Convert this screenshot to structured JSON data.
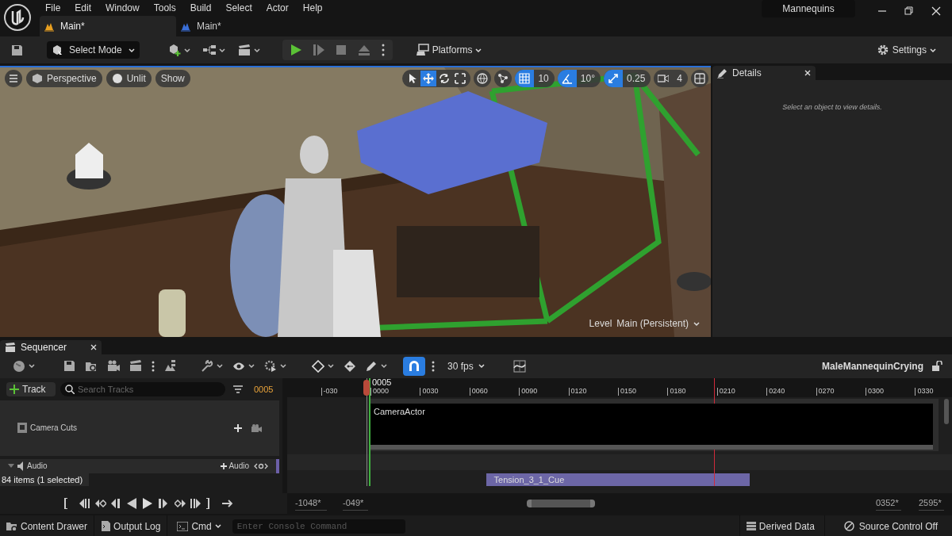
{
  "menu": [
    "File",
    "Edit",
    "Window",
    "Tools",
    "Build",
    "Select",
    "Actor",
    "Help"
  ],
  "tabs": [
    {
      "label": "Main*",
      "selected": true
    },
    {
      "label": "Main*",
      "selected": false
    }
  ],
  "project": "Mannequins",
  "toolbar": {
    "mode": "Select Mode",
    "platforms": "Platforms",
    "settings": "Settings"
  },
  "viewport": {
    "view_buttons": [
      "Perspective",
      "Unlit",
      "Show"
    ],
    "transform_tools": [
      {
        "selected": false
      },
      {
        "selected": true
      },
      {
        "selected": false
      },
      {
        "selected": false
      }
    ],
    "snaps": [
      {
        "kind": "grid",
        "value": "10",
        "on": true
      },
      {
        "kind": "angle",
        "value": "10°",
        "on": true
      },
      {
        "kind": "scale",
        "value": "0.25",
        "on": true
      },
      {
        "kind": "camera",
        "value": "4",
        "on": false
      }
    ],
    "level_label": "Level",
    "level": "Main (Persistent)"
  },
  "details": {
    "title": "Details",
    "message": "Select an object to view details."
  },
  "sequencer": {
    "title": "Sequencer",
    "fps": "30 fps",
    "snapping": {
      "on": true
    },
    "sequence": "MaleMannequinCrying",
    "add_track": "Track",
    "search_placeholder": "Search Tracks",
    "current_frame": "0005",
    "playhead": "0005",
    "ticks": [
      "-030",
      "0000",
      "0030",
      "0060",
      "0090",
      "0120",
      "0150",
      "0180",
      "0210",
      "0240",
      "0270",
      "0300",
      "0330"
    ],
    "tracks": [
      {
        "kind": "camera_cuts",
        "name": "Camera Cuts",
        "section": "CameraActor"
      },
      {
        "kind": "audio",
        "name": "Audio",
        "add": "Audio",
        "section": "Tension_3_1_Cue"
      }
    ],
    "item_count": "84 items (1 selected)",
    "range": [
      "-1048*",
      "-049*",
      "0352*",
      "2595*"
    ]
  },
  "status_bar": {
    "content_drawer": "Content Drawer",
    "output_log": "Output Log",
    "cmd": "Cmd",
    "console_placeholder": "Enter Console Command",
    "derived_data": "Derived Data",
    "source_control": "Source Control Off"
  }
}
